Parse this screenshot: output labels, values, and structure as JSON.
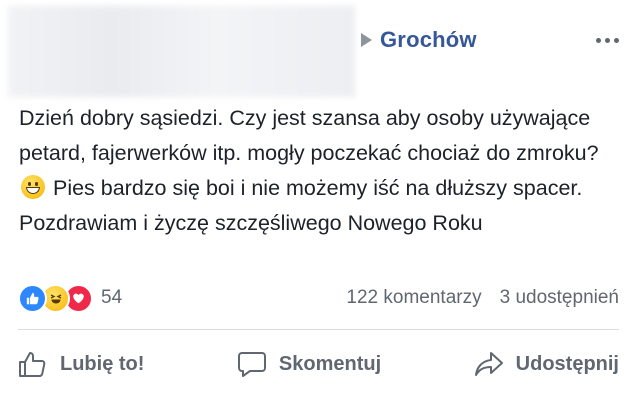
{
  "post": {
    "group_name": "Grochów",
    "text_part1": "Dzień dobry sąsiedzi. Czy jest szansa aby osoby używające petard, fajerwerków itp. mogły poczekać chociaż do zmroku?",
    "text_part2": " Pies bardzo się boi i nie możemy iść na dłuższy spacer. Pozdrawiam i życzę szczęśliwego Nowego Roku"
  },
  "stats": {
    "reaction_count": "54",
    "comments": "122 komentarzy",
    "shares": "3 udostępnień"
  },
  "actions": {
    "like": "Lubię to!",
    "comment": "Skomentuj",
    "share": "Udostępnij"
  },
  "colors": {
    "group_link": "#365899",
    "muted": "#606770",
    "like_blue": "#2d88ff",
    "love_red": "#f0284a"
  }
}
